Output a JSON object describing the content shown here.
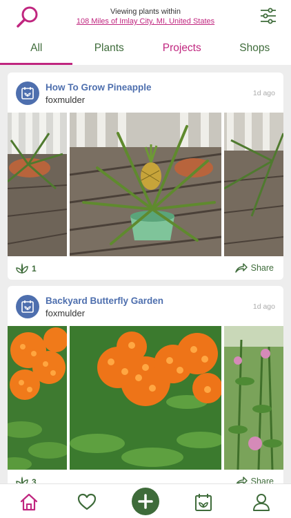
{
  "header": {
    "search_icon": "search-icon",
    "location_prefix": "Viewing plants within",
    "location_link": "108 Miles of Imlay City, MI, United States",
    "filter_icon": "sliders-icon"
  },
  "tabs": [
    {
      "label": "All",
      "active": true
    },
    {
      "label": "Plants",
      "active": false
    },
    {
      "label": "Projects",
      "active": false
    },
    {
      "label": "Shops",
      "active": false
    }
  ],
  "posts": [
    {
      "title": "How To Grow Pineapple",
      "user": "foxmulder",
      "time": "1d ago",
      "likes": "1",
      "share_label": "Share"
    },
    {
      "title": "Backyard Butterfly Garden",
      "user": "foxmulder",
      "time": "1d ago",
      "likes": "3",
      "share_label": "Share"
    }
  ],
  "bottom_nav": [
    "home-icon",
    "heart-icon",
    "add-icon",
    "projects-icon",
    "profile-icon"
  ],
  "colors": {
    "accent_pink": "#c0267f",
    "green": "#3e6b3a",
    "project_blue": "#4e6fae"
  }
}
